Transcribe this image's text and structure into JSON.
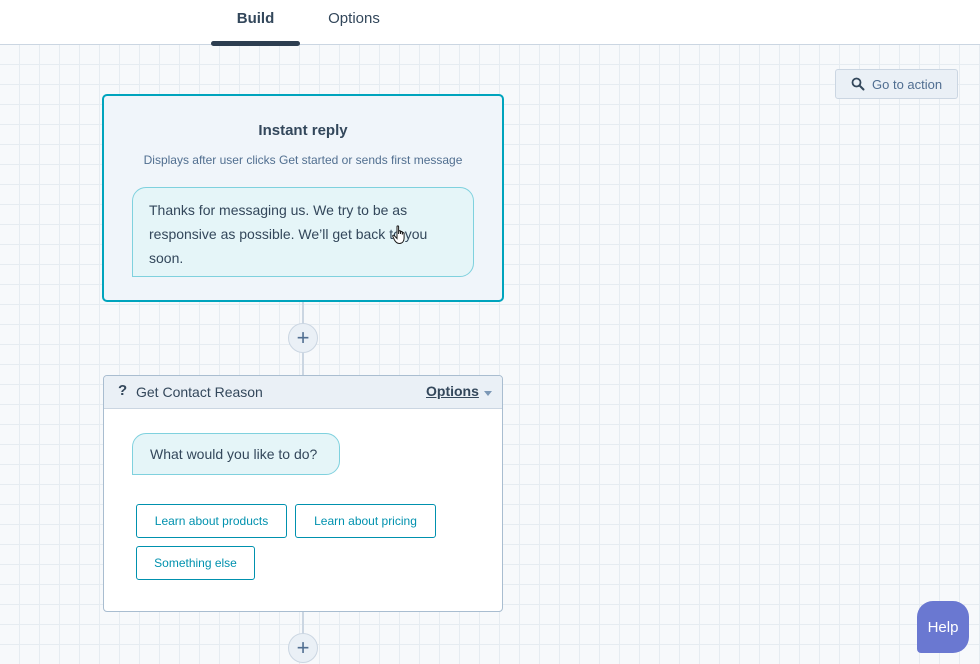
{
  "tabs": [
    {
      "label": "Build",
      "active": true
    },
    {
      "label": "Options",
      "active": false
    }
  ],
  "toolbar": {
    "go_to_action": "Go to action",
    "icon": "search-icon"
  },
  "instant_reply": {
    "title": "Instant reply",
    "subtitle": "Displays after user clicks Get started or sends first message",
    "message": "Thanks for messaging us. We try to be as responsive as possible. We’ll get back to you soon."
  },
  "contact_reason": {
    "icon": "question-icon",
    "title": "Get Contact Reason",
    "options_label": "Options",
    "question": "What would you like to do?",
    "choices": [
      "Learn about products",
      "Learn about pricing",
      "Something else"
    ]
  },
  "add_step_icon": "+",
  "help": {
    "label": "Help"
  },
  "colors": {
    "accent": "#00a4bd",
    "choice_text": "#0091ae",
    "bubble_bg": "#e5f5f8",
    "help_bg": "#6a78d1",
    "tab_underline": "#2d3e50"
  }
}
